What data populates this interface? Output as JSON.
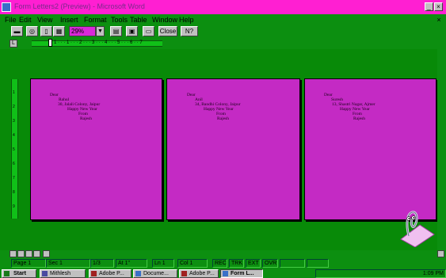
{
  "window": {
    "title": "Form Letters2 (Preview) - Microsoft Word"
  },
  "menu": [
    "File",
    "Edit",
    "View",
    "Insert",
    "Format",
    "Tools",
    "Table",
    "Window",
    "Help"
  ],
  "toolbar": {
    "zoom": "29%",
    "close_label": "Close",
    "help_label": "N?"
  },
  "ruler": {
    "numbers": "1 · · · 1 · · · 2 · · · 3 · · · 4 · · · 5 · · · 6 · · 7"
  },
  "vruler": {
    "numbers": [
      "1",
      "2",
      "3",
      "4",
      "5",
      "6",
      "7",
      "8",
      "9"
    ]
  },
  "letters": [
    {
      "salutation": "Dear",
      "name": "Rahul",
      "address": "30, Jalali Colony, Jaipur",
      "greeting": "Happy New Year",
      "from": "From",
      "sender": "Rajesh"
    },
    {
      "salutation": "Dear",
      "name": "Anil",
      "address": "34, Bandhi Colony, Jaipur",
      "greeting": "Happy New Year",
      "from": "From",
      "sender": "Rajesh"
    },
    {
      "salutation": "Dear",
      "name": "Suresh",
      "address": "13, Shastri Nagar, Ajmer",
      "greeting": "Happy New Year",
      "from": "From",
      "sender": "Rajesh"
    }
  ],
  "status": {
    "page": "Page 1",
    "sec": "Sec 1",
    "pages": "1/3",
    "at": "At 1\"",
    "ln": "Ln 1",
    "col": "Col 1",
    "rec": "REC",
    "trk": "TRK",
    "ext": "EXT",
    "ovr": "OVR"
  },
  "taskbar": {
    "start": "Start",
    "items": [
      "Mithlesh",
      "Adobe P...",
      "Docume...",
      "Adobe P...",
      "Form L..."
    ],
    "clock": "1:09 PM"
  },
  "colors": {
    "title": "#ff1fd2",
    "page": "#c42ac4",
    "workspace": "#088a08"
  },
  "icons": [
    "word-icon",
    "print-icon",
    "magnifier-icon",
    "one-page-icon",
    "multi-page-icon",
    "ruler-icon",
    "shrink-to-fit-icon",
    "full-screen-icon",
    "help-icon",
    "office-assistant-icon"
  ]
}
